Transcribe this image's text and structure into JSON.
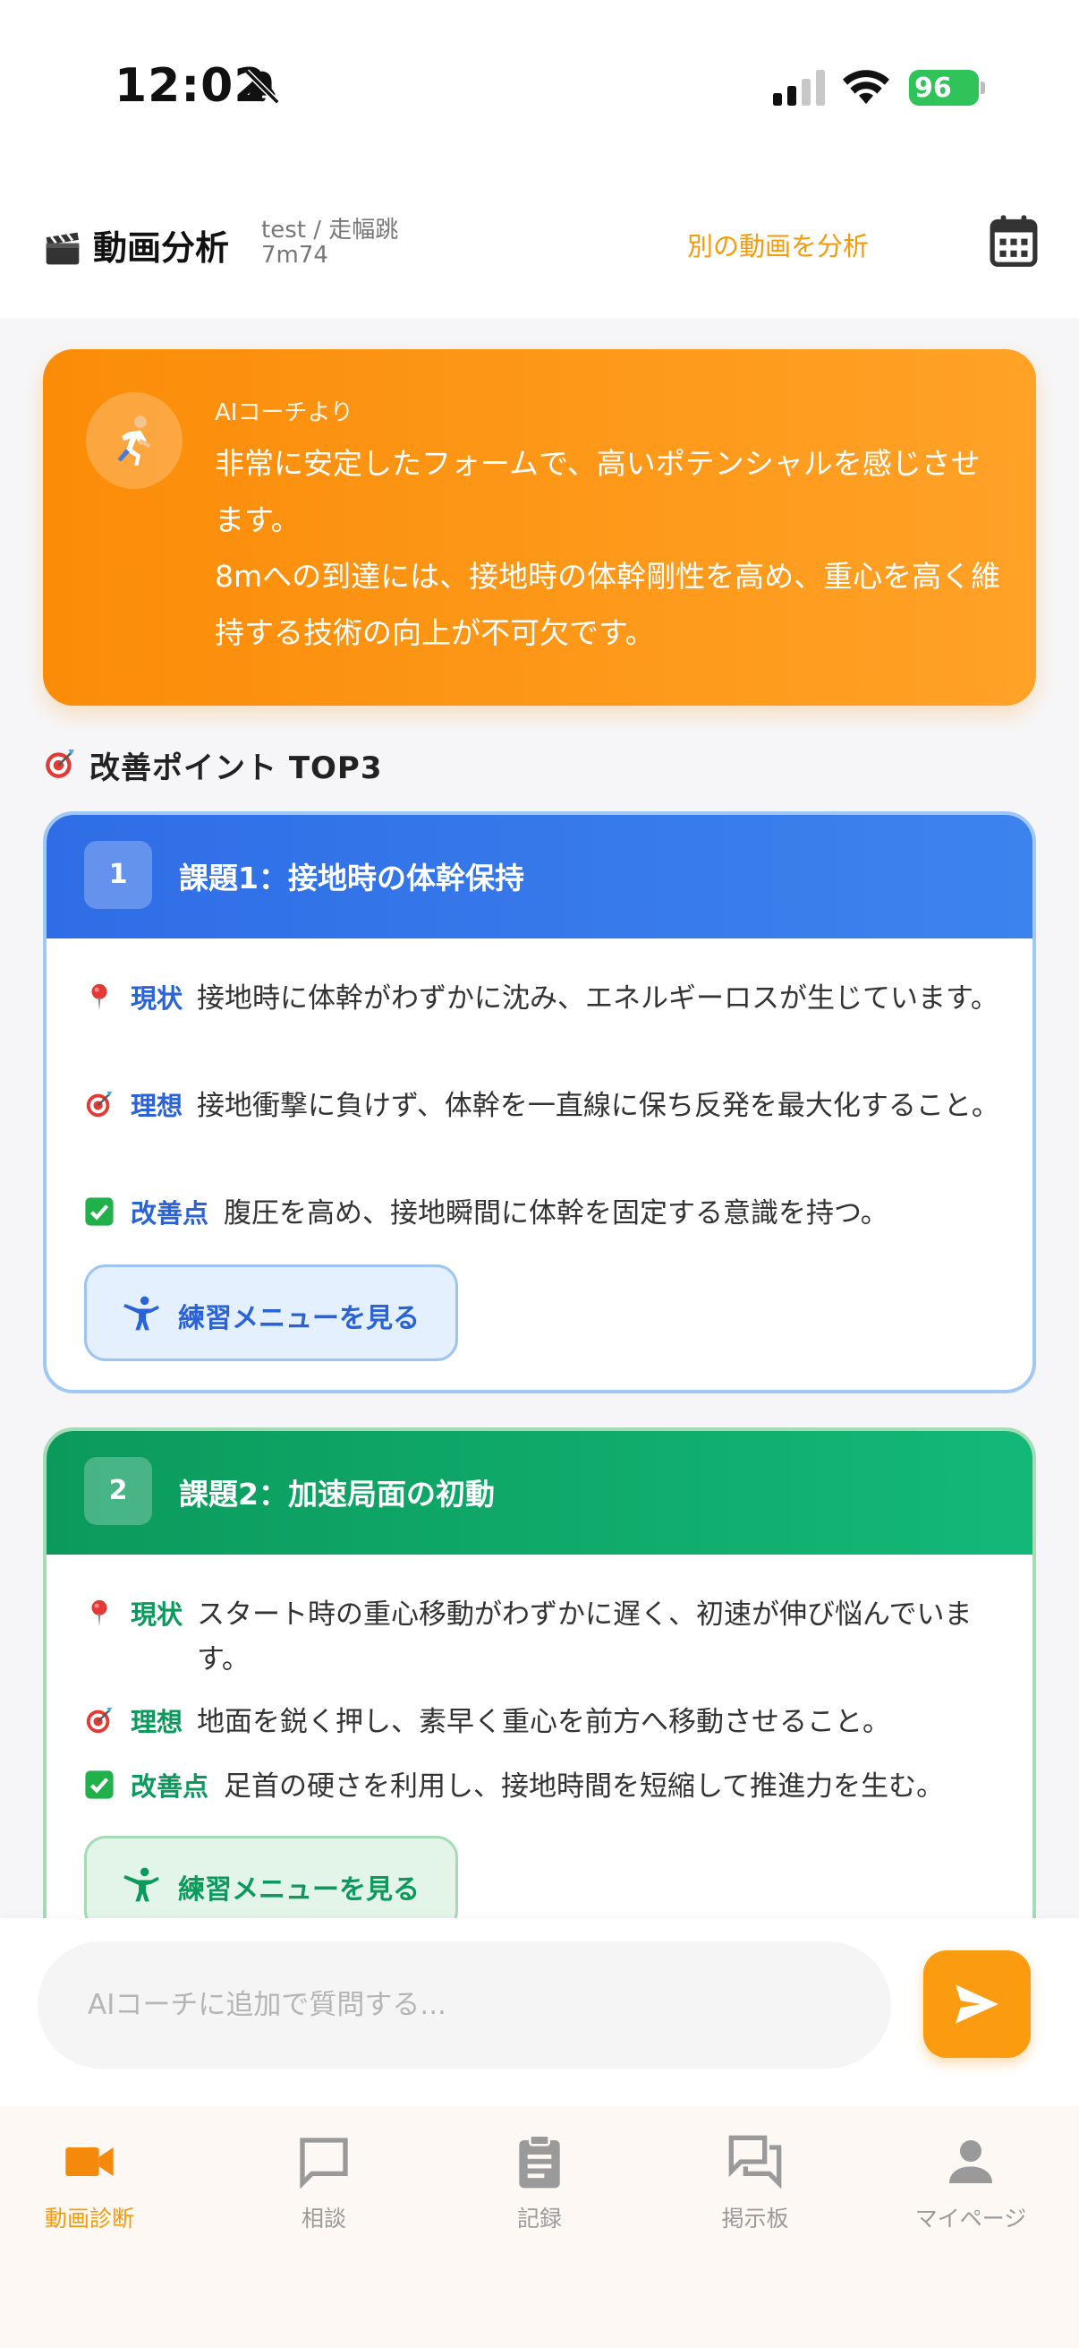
{
  "status_bar": {
    "time": "12:02",
    "battery": "96"
  },
  "header": {
    "title": "動画分析",
    "sub_line1": "test / 走幅跳",
    "sub_line2": "7m74",
    "link_label": "別の動画を分析",
    "calendar_icon": "calendar-icon"
  },
  "coach": {
    "from_label": "AIコーチより",
    "message": "非常に安定したフォームで、高いポテンシャルを感じさせます。\n8mへの到達には、接地時の体幹剛性を高め、重心を高く維持する技術の向上が不可欠です。"
  },
  "section": {
    "title": "改善ポイント TOP3"
  },
  "issues": [
    {
      "number": "1",
      "title": "課題1：接地時の体幹保持",
      "current_label": "現状",
      "current_text": "接地時に体幹がわずかに沈み、エネルギーロスが生じています。",
      "ideal_label": "理想",
      "ideal_text": "接地衝撃に負けず、体幹を一直線に保ち反発を最大化すること。",
      "fix_label": "改善点",
      "fix_text": "腹圧を高め、接地瞬間に体幹を固定する意識を持つ。",
      "button_label": "練習メニューを見る",
      "accent": "#2f6de6"
    },
    {
      "number": "2",
      "title": "課題2：加速局面の初動",
      "current_label": "現状",
      "current_text": "スタート時の重心移動がわずかに遅く、初速が伸び悩んでいます。",
      "ideal_label": "理想",
      "ideal_text": "地面を鋭く押し、素早く重心を前方へ移動させること。",
      "fix_label": "改善点",
      "fix_text": "足首の硬さを利用し、接地時間を短縮して推進力を生む。",
      "button_label": "練習メニューを見る",
      "accent": "#0b9a5c"
    }
  ],
  "chat": {
    "placeholder": "AIコーチに追加で質問する...",
    "send_icon": "send-icon"
  },
  "nav": {
    "items": [
      {
        "label": "動画診断",
        "icon": "video-camera-icon",
        "active": true
      },
      {
        "label": "相談",
        "icon": "chat-bubble-icon",
        "active": false
      },
      {
        "label": "記録",
        "icon": "clipboard-icon",
        "active": false
      },
      {
        "label": "掲示板",
        "icon": "forum-icon",
        "active": false
      },
      {
        "label": "マイページ",
        "icon": "person-icon",
        "active": false
      }
    ]
  },
  "colors": {
    "accent_orange": "#fb9b10",
    "issue1_blue": "#2f6de6",
    "issue2_green": "#0b9a5c"
  }
}
